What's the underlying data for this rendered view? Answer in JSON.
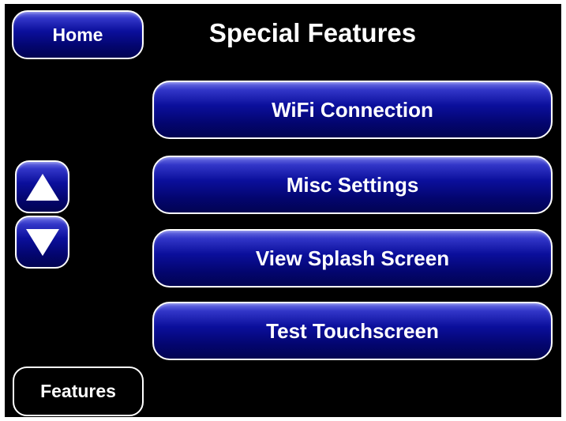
{
  "header": {
    "home_label": "Home",
    "title": "Special Features"
  },
  "menu": {
    "items": [
      {
        "label": "WiFi Connection"
      },
      {
        "label": "Misc Settings"
      },
      {
        "label": "View Splash Screen"
      },
      {
        "label": "Test Touchscreen"
      }
    ]
  },
  "scroll": {
    "up_icon": "triangle-up-icon",
    "down_icon": "triangle-down-icon"
  },
  "footer": {
    "features_label": "Features"
  },
  "colors": {
    "background": "#000000",
    "button_top": "#6f73e6",
    "button_bottom": "#020452",
    "border": "#ffffff",
    "text": "#ffffff"
  }
}
